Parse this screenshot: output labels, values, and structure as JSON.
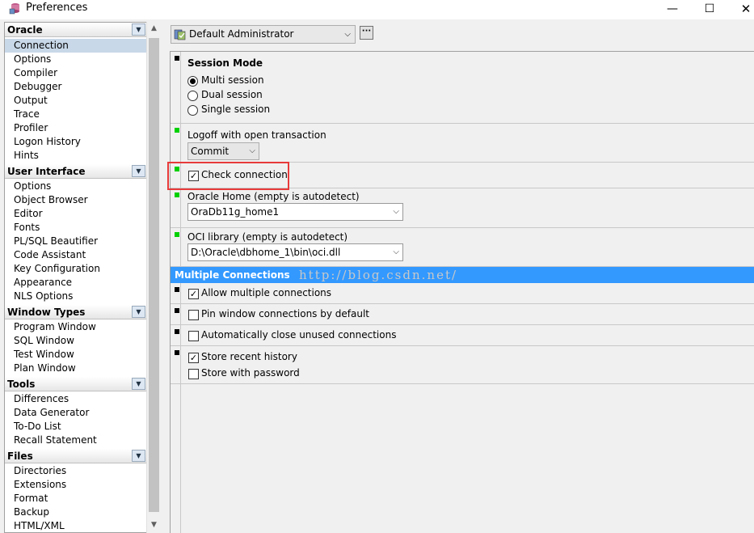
{
  "window": {
    "title": "Preferences",
    "minimize": "—",
    "maximize": "☐",
    "close": "✕"
  },
  "profile": {
    "value": "Default Administrator",
    "more": "···"
  },
  "nav": {
    "groups": [
      {
        "header": "Oracle",
        "items": [
          "Connection",
          "Options",
          "Compiler",
          "Debugger",
          "Output",
          "Trace",
          "Profiler",
          "Logon History",
          "Hints"
        ]
      },
      {
        "header": "User Interface",
        "items": [
          "Options",
          "Object Browser",
          "Editor",
          "Fonts",
          "PL/SQL Beautifier",
          "Code Assistant",
          "Key Configuration",
          "Appearance",
          "NLS Options"
        ]
      },
      {
        "header": "Window Types",
        "items": [
          "Program Window",
          "SQL Window",
          "Test Window",
          "Plan Window"
        ]
      },
      {
        "header": "Tools",
        "items": [
          "Differences",
          "Data Generator",
          "To-Do List",
          "Recall Statement"
        ]
      },
      {
        "header": "Files",
        "items": [
          "Directories",
          "Extensions",
          "Format",
          "Backup",
          "HTML/XML"
        ]
      }
    ],
    "selected": "Connection"
  },
  "session_mode": {
    "title": "Session Mode",
    "options": [
      "Multi session",
      "Dual session",
      "Single session"
    ],
    "selected": "Multi session"
  },
  "logoff": {
    "label": "Logoff with open transaction",
    "value": "Commit"
  },
  "check_connection": {
    "label": "Check connection",
    "checked": true
  },
  "oracle_home": {
    "label": "Oracle Home (empty is autodetect)",
    "value": "OraDb11g_home1"
  },
  "oci_library": {
    "label": "OCI library (empty is autodetect)",
    "value": "D:\\Oracle\\dbhome_1\\bin\\oci.dll"
  },
  "multiple_connections": {
    "header": "Multiple Connections",
    "allow": {
      "label": "Allow multiple connections",
      "checked": true
    },
    "pin": {
      "label": "Pin window connections by default",
      "checked": false
    },
    "auto_close": {
      "label": "Automatically close unused connections",
      "checked": false
    },
    "store_history": {
      "label": "Store recent history",
      "checked": true
    },
    "store_password": {
      "label": "Store with password",
      "checked": false
    }
  },
  "watermark": "http://blog.csdn.net/",
  "colors": {
    "accent": "#3399ff",
    "highlight_box": "#e83a3a",
    "marker_green": "#00d000"
  },
  "icons": {
    "check": "✓",
    "chevron": "⌵",
    "dropdown": "▼"
  }
}
